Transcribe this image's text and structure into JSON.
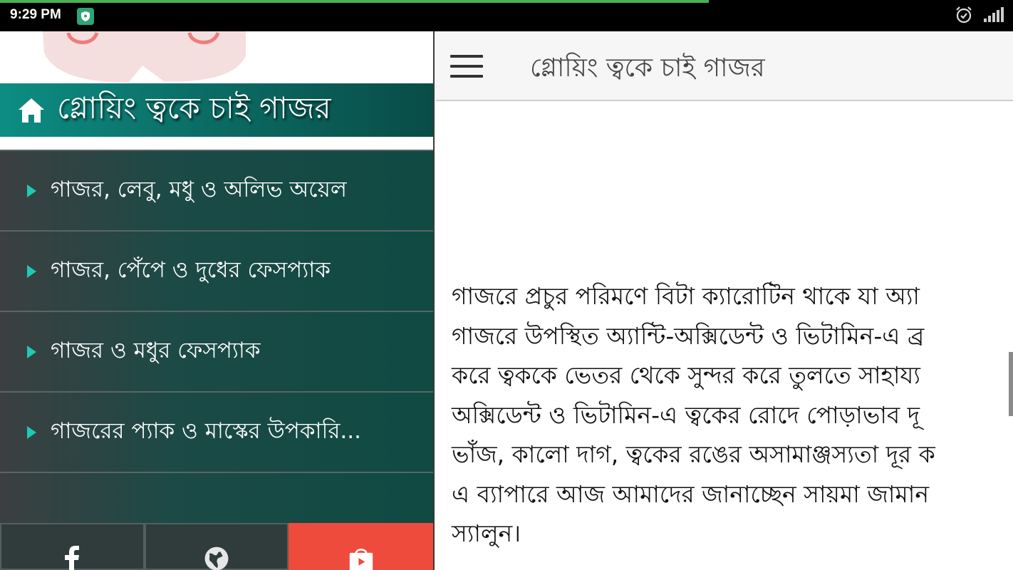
{
  "status_bar": {
    "time": "9:29 PM",
    "load_progress": 0.7
  },
  "drawer": {
    "header_title": "গ্লোয়িং ত্বকে চাই গাজর",
    "items": [
      {
        "label": "গাজর, লেবু, মধু ও অলিভ অয়েল"
      },
      {
        "label": "গাজর, পেঁপে ও দুধের ফেসপ্যাক"
      },
      {
        "label": "গাজর ও মধুর ফেসপ্যাক"
      },
      {
        "label": "গাজরের প্যাক ও মাস্কের উপকারি..."
      }
    ],
    "footer": {
      "facebook_icon": "facebook-icon",
      "web_icon": "globe-icon",
      "store_icon": "play-store-icon",
      "store_color": "#ef4b3c"
    }
  },
  "app_bar": {
    "title": "গ্লোয়িং ত্বকে চাই গাজর"
  },
  "article": {
    "lines": [
      "গাজরে প্রচুর পরিমণে বিটা ক্যারোটিন থাকে যা অ্যা",
      "গাজরে উপস্থিত অ্যান্টি-অক্সিডেন্ট ও ভিটামিন-এ ব্র",
      "করে ত্বককে ভেতর থেকে সুন্দর করে তুলতে সাহায্য",
      "অক্সিডেন্ট ও ভিটামিন-এ ত্বকের রোদে পোড়াভাব দূ",
      "ভাঁজ, কালো দাগ, ত্বকের রঙের অসামাঞ্জস্যতা দূর ক",
      "এ ব্যাপারে আজ আমাদের জানাচ্ছেন সায়মা জামান",
      "স্যালুন।"
    ]
  },
  "colors": {
    "drawer_header": "#0b6e66",
    "menu_arrow": "#1fc9b4",
    "progress": "#4caf50"
  }
}
